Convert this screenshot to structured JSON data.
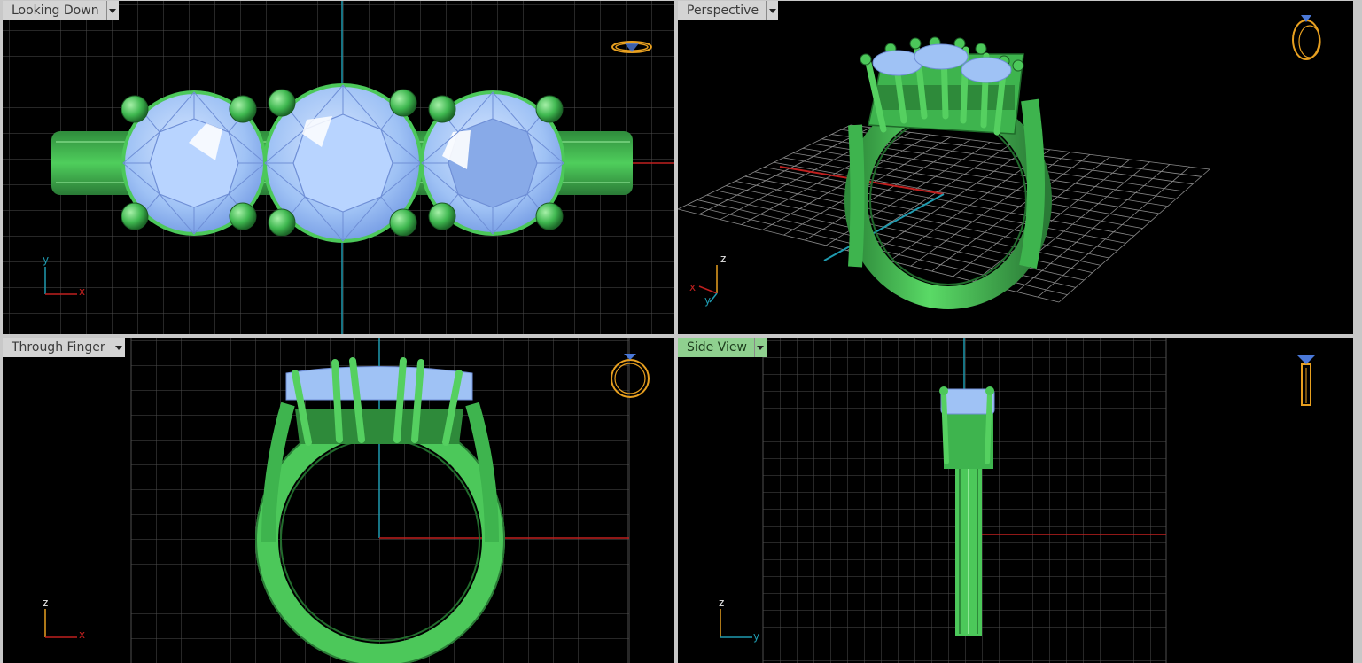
{
  "viewports": [
    {
      "name": "top",
      "title": "Looking Down",
      "active": false,
      "axes": {
        "vertical": "y",
        "horizontal": "x"
      }
    },
    {
      "name": "perspective",
      "title": "Perspective",
      "active": false,
      "axes": {
        "vertical": "z",
        "horizontal": "x",
        "depth": "y"
      }
    },
    {
      "name": "front",
      "title": "Through Finger",
      "active": false,
      "axes": {
        "vertical": "z",
        "horizontal": "x"
      }
    },
    {
      "name": "right",
      "title": "Side View",
      "active": true,
      "axes": {
        "vertical": "z",
        "horizontal": "y"
      }
    }
  ],
  "colors": {
    "metal": "#4cc85a",
    "metal_dark": "#2e8a3a",
    "gem": "#9fc2f5",
    "gem_edge": "#6f8fd6",
    "grid": "#555555",
    "axis_x": "#c0201f",
    "axis_y": "#1f9bb0",
    "thumb_gold": "#e8a020",
    "thumb_blue": "#4a78d8"
  }
}
